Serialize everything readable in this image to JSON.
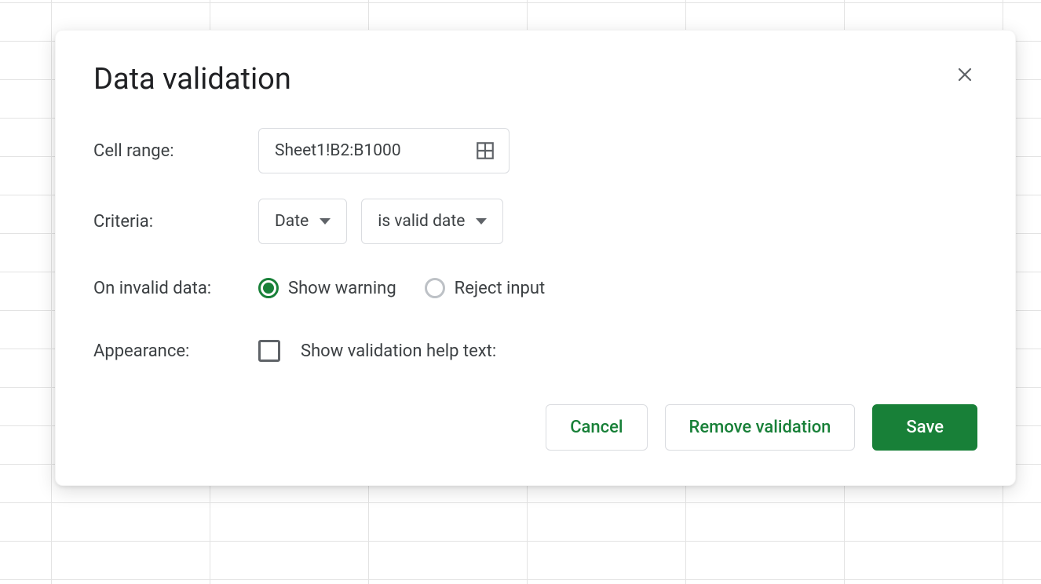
{
  "dialog": {
    "title": "Data validation",
    "labels": {
      "cell_range": "Cell range:",
      "criteria": "Criteria:",
      "on_invalid": "On invalid data:",
      "appearance": "Appearance:"
    },
    "cell_range_value": "Sheet1!B2:B1000",
    "criteria": {
      "type_label": "Date",
      "condition_label": "is valid date"
    },
    "on_invalid": {
      "show_warning_label": "Show warning",
      "show_warning_selected": true,
      "reject_input_label": "Reject input",
      "reject_input_selected": false
    },
    "appearance": {
      "checkbox_label": "Show validation help text:",
      "checked": false
    },
    "buttons": {
      "cancel": "Cancel",
      "remove": "Remove validation",
      "save": "Save"
    }
  }
}
